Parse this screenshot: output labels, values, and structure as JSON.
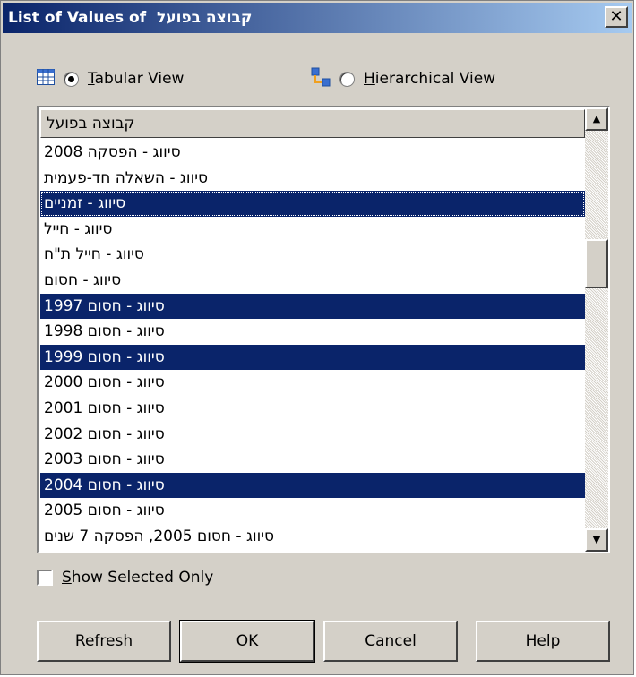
{
  "window": {
    "title_prefix": "List of Values of",
    "title_field": "קבוצה בפועל",
    "close_label": "✕"
  },
  "view": {
    "tabular_label": "Tabular View",
    "tabular_accel": "T",
    "tabular_rest": "abular View",
    "tabular_selected": true,
    "hier_label": "Hierarchical View",
    "hier_accel": "H",
    "hier_rest": "ierarchical View"
  },
  "list": {
    "column_header": "קבוצה בפועל",
    "rows": [
      {
        "text": "סיווג - הפסקה 2008",
        "selected": false
      },
      {
        "text": "סיווג - השאלה חד-פעמית",
        "selected": false
      },
      {
        "text": "סיווג - זמניים",
        "selected": true
      },
      {
        "text": "סיווג - חייל",
        "selected": false
      },
      {
        "text": "סיווג - חייל ת\"ח",
        "selected": false
      },
      {
        "text": "סיווג - חסום",
        "selected": false
      },
      {
        "text": "סיווג - חסום 1997",
        "selected": true
      },
      {
        "text": "סיווג - חסום 1998",
        "selected": false
      },
      {
        "text": "סיווג - חסום 1999",
        "selected": true
      },
      {
        "text": "סיווג - חסום 2000",
        "selected": false
      },
      {
        "text": "סיווג - חסום 2001",
        "selected": false
      },
      {
        "text": "סיווג - חסום 2002",
        "selected": false
      },
      {
        "text": "סיווג - חסום 2003",
        "selected": false
      },
      {
        "text": "סיווג - חסום 2004",
        "selected": true
      },
      {
        "text": "סיווג - חסום 2005",
        "selected": false
      },
      {
        "text": "סיווג - חסום 2005, הפסקה 7 שנים",
        "selected": false
      }
    ]
  },
  "show_selected": {
    "accel": "S",
    "rest": "how Selected Only",
    "checked": false
  },
  "buttons": {
    "refresh_accel": "R",
    "refresh_rest": "efresh",
    "ok": "OK",
    "cancel": "Cancel",
    "help_accel": "H",
    "help_rest": "elp"
  },
  "colors": {
    "selection": "#0a246a",
    "dialog_bg": "#d4d0c8"
  }
}
